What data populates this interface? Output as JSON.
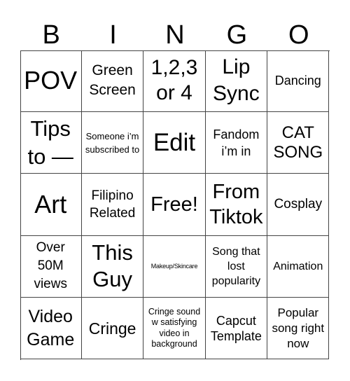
{
  "header": {
    "letters": [
      "B",
      "I",
      "N",
      "G",
      "O"
    ]
  },
  "grid": {
    "rows": [
      [
        "POV",
        "Green Screen",
        "1,2,3 or 4",
        "Lip Sync",
        "Dancing"
      ],
      [
        "Tips to —",
        "Someone i’m subscribed to",
        "Edit",
        "Fandom i’m in",
        "CAT SONG"
      ],
      [
        "Art",
        "Filipino Related",
        "Free!",
        "From Tiktok",
        "Cosplay"
      ],
      [
        "Over 50M views",
        "This Guy",
        "Makeup/Skincare",
        "Song that lost popularity",
        "Animation"
      ],
      [
        "Video Game",
        "Cringe",
        "Cringe sound w satisfying video in background",
        "Capcut Template",
        "Popular song right now"
      ]
    ],
    "free_space": "Free!"
  },
  "colors": {
    "background": "#ffffff",
    "grid_line": "#444444",
    "text": "#000000"
  }
}
